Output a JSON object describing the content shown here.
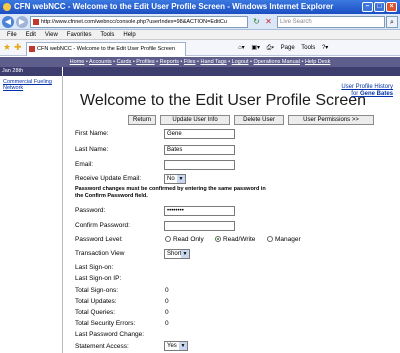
{
  "browser": {
    "title": "CFN webNCC - Welcome to the Edit User Profile Screen - Windows Internet Explorer",
    "url": "http://www.cfnnet.com/webncc/console.php?userIndex=98&ACTION=EditCu",
    "live_search_placeholder": "Live Search",
    "menu": [
      "File",
      "Edit",
      "View",
      "Favorites",
      "Tools",
      "Help"
    ],
    "tab_title": "CFN webNCC - Welcome to the Edit User Profile Screen",
    "tab_tools": [
      "Page",
      "Tools"
    ]
  },
  "site_nav": {
    "links": [
      "Home",
      "Accounts",
      "Cards",
      "Profiles",
      "Reports",
      "Files",
      "Hand Tags",
      "Logout",
      "Operations Manual",
      "Help Desk"
    ]
  },
  "date": "Jan 28th",
  "sidebar": {
    "items": [
      "Commercial Fueling Network"
    ]
  },
  "page": {
    "title": "Welcome to the Edit User Profile Screen",
    "history_link": "User Profile History for",
    "history_name": "Gene Bates"
  },
  "buttons": {
    "return": "Return",
    "update": "Update User Info",
    "delete": "Delete User",
    "permissions": "User Permissions >>"
  },
  "form": {
    "first_name_label": "First Name:",
    "first_name_value": "Gene",
    "last_name_label": "Last Name:",
    "last_name_value": "Bates",
    "email_label": "Email:",
    "email_value": "",
    "receive_label": "Receive Update Email:",
    "receive_value": "No",
    "password_note": "Password changes must be confirmed by entering the same password in the Confirm Password field.",
    "password_label": "Password:",
    "password_value": "••••••••",
    "confirm_label": "Confirm Password:",
    "confirm_value": "",
    "level_label": "Password Level:",
    "level_options": [
      "Read Only",
      "Read/Write",
      "Manager"
    ],
    "level_selected": "Read/Write",
    "transaction_label": "Transaction View",
    "transaction_value": "Short",
    "last_signon_label": "Last Sign-on:",
    "last_signon_ip_label": "Last Sign-on IP:",
    "total_signons_label": "Total Sign-ons:",
    "total_signons_value": "0",
    "total_updates_label": "Total Updates:",
    "total_updates_value": "0",
    "total_queries_label": "Total Queries:",
    "total_queries_value": "0",
    "total_security_label": "Total Security Errors:",
    "total_security_value": "0",
    "last_pw_change_label": "Last Password Change:",
    "statement_label": "Statement Access:",
    "statement_value": "Yes"
  }
}
